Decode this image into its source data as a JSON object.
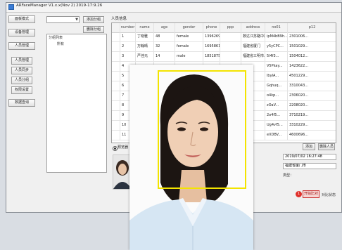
{
  "window": {
    "title": "ARFaceManager V1.x.x(Nov 2) 2019-17:9.26"
  },
  "nav": {
    "buttons": [
      "面板模式",
      "设备管理",
      "人员管理"
    ],
    "sub_buttons": [
      "人员管理",
      "人员同步",
      "人员分组",
      "权限设置"
    ],
    "bottom_button": "数据查询"
  },
  "tree": {
    "add_group": "添加分组",
    "remove_group": "删除分组",
    "header": "分组列表",
    "root": "所有"
  },
  "grid": {
    "caption": "人员信息",
    "columns": [
      "number",
      "name",
      "age",
      "gender",
      "phone",
      "ppp",
      "address",
      "no01",
      "p12"
    ],
    "rows": [
      {
        "n": "1",
        "name": "丁晓雅",
        "age": "48",
        "gender": "female",
        "phone": "13962694564",
        "address": "数达江苏路中路",
        "no01": "ipM4bB9h...",
        "p12": "2301006..."
      },
      {
        "n": "2",
        "name": "万翰晴",
        "age": "32",
        "gender": "female",
        "phone": "16958614147",
        "address": "福建省厦门",
        "no01": "y5yCPC...",
        "p12": "1501029..."
      },
      {
        "n": "3",
        "name": "严佳元",
        "age": "14",
        "gender": "male",
        "phone": "18518756582",
        "address": "福建省三明市...",
        "no01": "5l4f3...",
        "p12": "1504012..."
      },
      {
        "n": "4",
        "name": "",
        "age": "",
        "gender": "",
        "phone": "",
        "address": "",
        "no01": "V5Pkay...",
        "p12": "1423622..."
      },
      {
        "n": "5",
        "name": "",
        "age": "",
        "gender": "",
        "phone": "",
        "address": "",
        "no01": "lbyIA...",
        "p12": "4501229..."
      },
      {
        "n": "6",
        "name": "",
        "age": "",
        "gender": "",
        "phone": "",
        "address": "",
        "no01": "Gqhuq...",
        "p12": "3310043..."
      },
      {
        "n": "7",
        "name": "",
        "age": "",
        "gender": "",
        "phone": "",
        "address": "",
        "no01": "o4kp...",
        "p12": "2306020..."
      },
      {
        "n": "8",
        "name": "",
        "age": "",
        "gender": "",
        "phone": "",
        "address": "",
        "no01": "zOaV...",
        "p12": "2208020..."
      },
      {
        "n": "9",
        "name": "",
        "age": "",
        "gender": "",
        "phone": "",
        "address": "",
        "no01": "2o4f5...",
        "p12": "3710219..."
      },
      {
        "n": "10",
        "name": "",
        "age": "",
        "gender": "",
        "phone": "",
        "address": "",
        "no01": "Ug4vf5...",
        "p12": "3310229..."
      },
      {
        "n": "11",
        "name": "",
        "age": "",
        "gender": "",
        "phone": "",
        "address": "",
        "no01": "eXDBV...",
        "p12": "4600696..."
      }
    ]
  },
  "preview": {
    "label": "预览器"
  },
  "right": {
    "add": "添加",
    "delete_btn": "删除人员",
    "time": "2019/07/02 16:27:48",
    "addr": "福建省厦门市",
    "type_lbl": "类型：",
    "badge": "1",
    "start": "开始比对",
    "compare_status": "对比状态"
  }
}
